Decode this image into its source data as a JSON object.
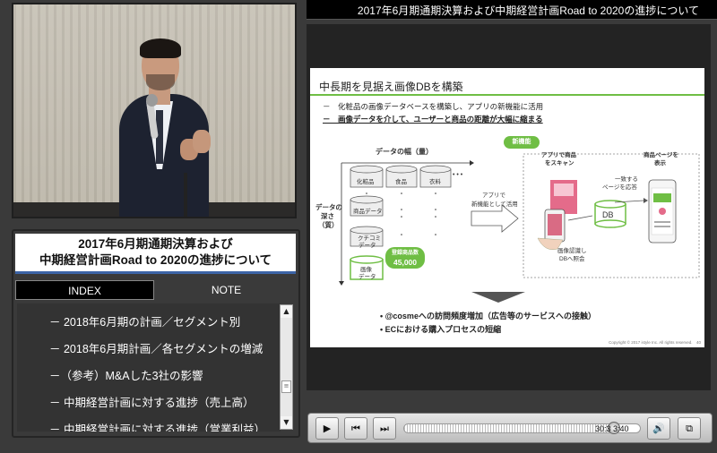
{
  "window": {
    "title": "2017年6月期通期決算および中期経営計画Road to 2020の進捗について"
  },
  "panel": {
    "title_line1": "2017年6月期通期決算および",
    "title_line2": "中期経営計画Road to 2020の進捗について"
  },
  "tabs": [
    {
      "label": "INDEX",
      "active": true
    },
    {
      "label": "NOTE",
      "active": false
    }
  ],
  "index": {
    "items": [
      "－ 2018年6月期の計画／セグメント別",
      "－ 2018年6月期計画／各セグメントの増減",
      "－（参考）M&Aした3社の影響",
      "－ 中期経営計画に対する進捗（売上高）",
      "－ 中期経営計画に対する進捗（営業利益）"
    ]
  },
  "slide": {
    "heading": "中長期を見据え画像DBを構築",
    "bullet1": "－　化粧品の画像データベースを構築し、アプリの新機能に活用",
    "bullet2": "－　画像データを介して、ユーザーと商品の距離が大幅に縮まる",
    "width_label": "データの幅（量）",
    "depth_label_1": "データの",
    "depth_label_2": "深さ",
    "depth_label_3": "（質）",
    "col_cosmetics": "化粧品",
    "col_food": "食品",
    "col_clothing": "衣料",
    "ellipsis": "• • •",
    "row_product_data": "商品データ",
    "row_review_data_1": "クチコミ",
    "row_review_data_2": "データ",
    "row_image_data_1": "画像",
    "row_image_data_2": "データ",
    "registered_label": "登録商品数",
    "registered_count": "45,000",
    "arrow_label_1": "アプリで",
    "arrow_label_2": "新機能として活用",
    "new_feature": "新機能",
    "scan_label_1": "アプリで商品",
    "scan_label_2": "をスキャン",
    "match_label_1": "一致する",
    "match_label_2": "ページを応答",
    "product_page_1": "商品ページを",
    "product_page_2": "表示",
    "db_label": "DB",
    "recog_label_1": "画像認識し",
    "recog_label_2": "DBへ照会",
    "conclusion1": "• @cosmeへの訪問頻度増加（広告等のサービスへの接触）",
    "conclusion2": "• ECにおける購入プロセスの短縮",
    "footer": "Copyright © 2017 istyle Inc. All rights reserved.　40"
  },
  "player": {
    "time": "30:3 3:40",
    "progress": 0.89,
    "play_icon": "play-icon",
    "prev_icon": "skip-back-icon",
    "next_icon": "skip-forward-icon",
    "volume_icon": "volume-icon",
    "layout_icon": "window-layout-icon"
  }
}
